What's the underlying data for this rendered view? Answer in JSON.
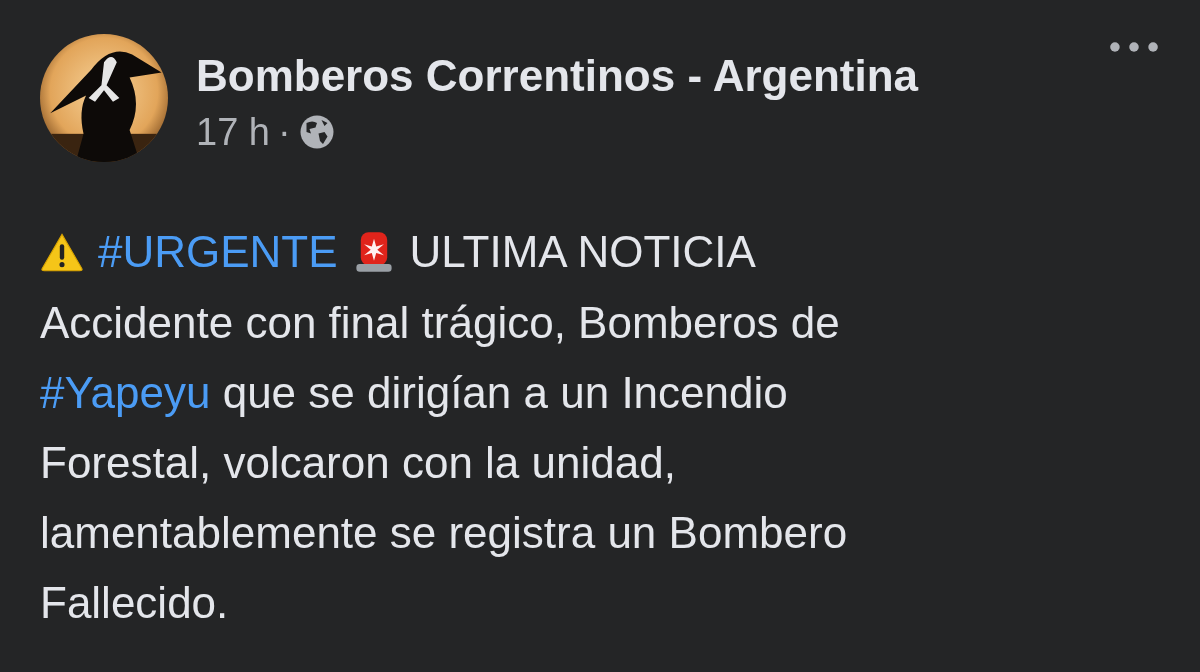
{
  "post": {
    "author": "Bomberos Correntinos - Argentina",
    "time": "17 h",
    "separator": "·",
    "headline": [
      {
        "kind": "warning"
      },
      {
        "kind": "hashtag",
        "text": "#URGENTE"
      },
      {
        "kind": "siren"
      },
      {
        "kind": "text",
        "text": "ULTIMA NOTICIA"
      }
    ],
    "body_lines": [
      [
        {
          "kind": "text",
          "text": "Accidente con final trágico, Bomberos de"
        }
      ],
      [
        {
          "kind": "hashtag",
          "text": "#Yapeyu"
        },
        {
          "kind": "text",
          "text": " que se dirigían a un Incendio"
        }
      ],
      [
        {
          "kind": "text",
          "text": "Forestal, volcaron con la unidad,"
        }
      ],
      [
        {
          "kind": "text",
          "text": "lamentablemente se registra un Bombero"
        }
      ],
      [
        {
          "kind": "text",
          "text": "Fallecido."
        }
      ]
    ]
  }
}
